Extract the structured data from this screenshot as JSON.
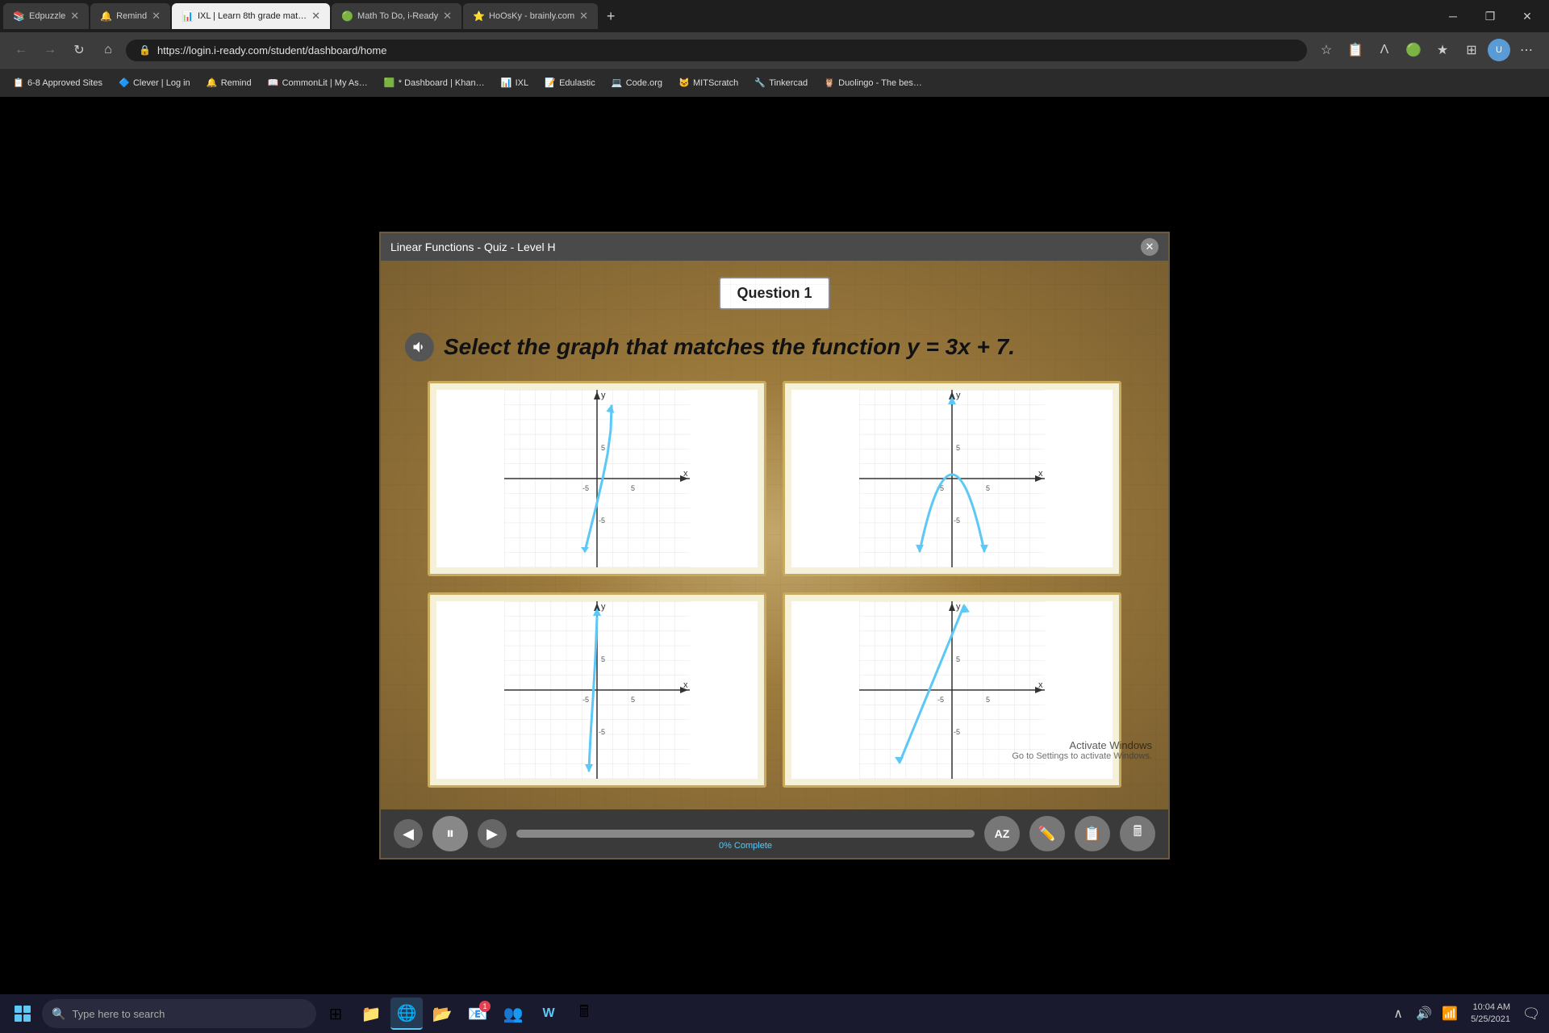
{
  "browser": {
    "tabs": [
      {
        "id": "edpuzzle",
        "label": "Edpuzzle",
        "favicon": "📚",
        "active": false
      },
      {
        "id": "remind",
        "label": "Remind",
        "favicon": "🔔",
        "active": false
      },
      {
        "id": "ixl",
        "label": "IXL | Learn 8th grade mat…",
        "favicon": "📊",
        "active": true
      },
      {
        "id": "iready",
        "label": "Math To Do, i-Ready",
        "favicon": "🟢",
        "active": false
      },
      {
        "id": "brainly",
        "label": "HoOsKy - brainly.com",
        "favicon": "⭐",
        "active": false
      }
    ],
    "url": "https://login.i-ready.com/student/dashboard/home",
    "bookmarks": [
      {
        "label": "6-8 Approved Sites",
        "favicon": "📋"
      },
      {
        "label": "Clever | Log in",
        "favicon": "🔷"
      },
      {
        "label": "Remind",
        "favicon": "🔔"
      },
      {
        "label": "CommonLit | My As…",
        "favicon": "📖"
      },
      {
        "label": "* Dashboard | Khan…",
        "favicon": "🟩"
      },
      {
        "label": "IXL",
        "favicon": "📊"
      },
      {
        "label": "Edulastic",
        "favicon": "📝"
      },
      {
        "label": "Code.org",
        "favicon": "💻"
      },
      {
        "label": "MITScratch",
        "favicon": "🐱"
      },
      {
        "label": "Tinkercad",
        "favicon": "🔧"
      },
      {
        "label": "Duolingo - The bes…",
        "favicon": "🦉"
      }
    ]
  },
  "modal": {
    "title": "Linear Functions - Quiz - Level H",
    "question_number": "Question 1",
    "question_text": "Select the graph that matches the function y = 3x + 7.",
    "progress_label": "0% Complete",
    "graphs": [
      {
        "id": "graph-a",
        "type": "steep-up-right"
      },
      {
        "id": "graph-b",
        "type": "parabola-down"
      },
      {
        "id": "graph-c",
        "type": "curve-left-steep"
      },
      {
        "id": "graph-d",
        "type": "steep-linear-right"
      }
    ]
  },
  "taskbar": {
    "search_placeholder": "Type here to search",
    "clock_time": "10:04 AM",
    "clock_date": "5/25/2021",
    "apps": [
      {
        "label": "Task View",
        "icon": "⊞"
      },
      {
        "label": "File Explorer",
        "icon": "📁"
      },
      {
        "label": "Edge Browser",
        "icon": "🌐"
      },
      {
        "label": "File Manager",
        "icon": "📂"
      },
      {
        "label": "Mail",
        "icon": "📧"
      },
      {
        "label": "Teams",
        "icon": "👥"
      },
      {
        "label": "Word",
        "icon": "W"
      },
      {
        "label": "Calculator",
        "icon": "🖩"
      }
    ]
  }
}
